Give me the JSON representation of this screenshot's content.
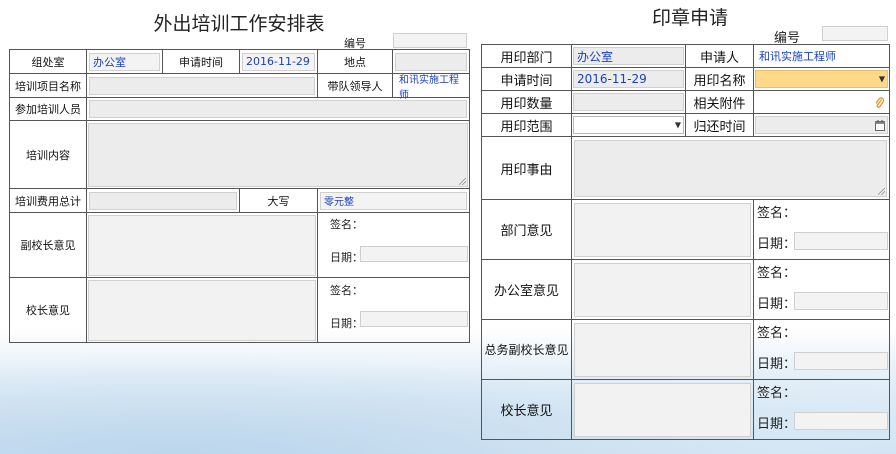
{
  "left_form": {
    "title": "外出培训工作安排表",
    "number_label": "编号",
    "rows": {
      "dept_label": "组处室",
      "dept_value": "办公室",
      "apply_time_label": "申请时间",
      "apply_time_value": "2016-11-29",
      "location_label": "地点",
      "project_label": "培训项目名称",
      "leader_label": "带队领导人",
      "leader_value": "和讯实施工程师",
      "participants_label": "参加培训人员",
      "content_label": "培训内容",
      "cost_label": "培训费用总计",
      "capital_label": "大写",
      "capital_value": "零元整",
      "vp_opinion_label": "副校长意见",
      "principal_opinion_label": "校长意见",
      "sign_label": "签名：",
      "date_label": "日期："
    }
  },
  "right_form": {
    "title": "印章申请",
    "number_label": "编号",
    "rows": {
      "dept_label": "用印部门",
      "dept_value": "办公室",
      "applicant_label": "申请人",
      "applicant_value": "和讯实施工程师",
      "apply_time_label": "申请时间",
      "apply_time_value": "2016-11-29",
      "seal_name_label": "用印名称",
      "seal_count_label": "用印数量",
      "attachment_label": "相关附件",
      "scope_label": "用印范围",
      "return_time_label": "归还时间",
      "reason_label": "用印事由",
      "dept_opinion_label": "部门意见",
      "office_opinion_label": "办公室意见",
      "gvp_opinion_label": "总务副校长意见",
      "principal_opinion_label": "校长意见",
      "sign_label": "签名：",
      "date_label": "日期："
    }
  },
  "colors": {
    "highlight_field": "#ffd98a",
    "value_text": "#1a3fbf"
  },
  "icons": [
    "paperclip-icon",
    "calendar-icon",
    "chevron-down-icon",
    "resize-grip-icon"
  ]
}
